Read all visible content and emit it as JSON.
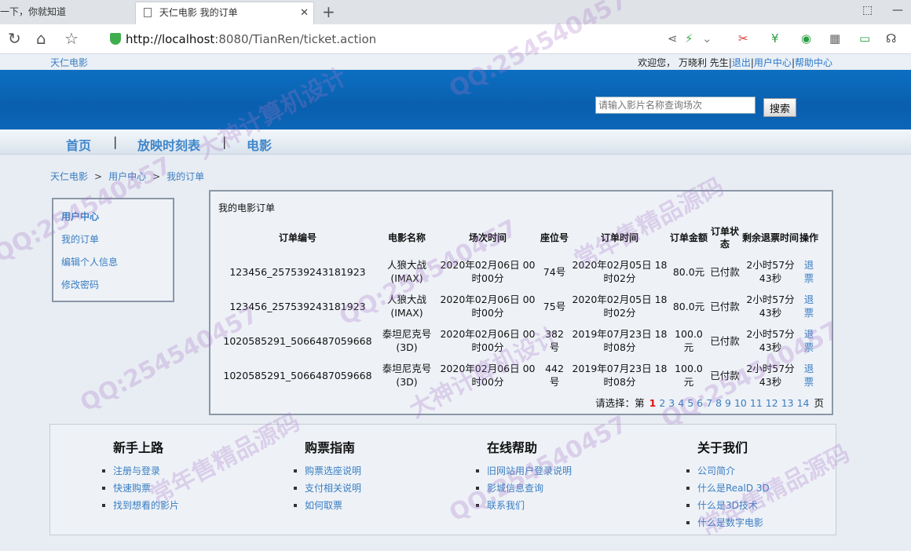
{
  "browser": {
    "inactive_tab_title": "一下，你就知道",
    "active_tab_title": "天仁电影 我的订单",
    "url_host": "http://localhost",
    "url_rest": ":8080/TianRen/ticket.action"
  },
  "site": {
    "name": "天仁电影",
    "welcome_text": "欢迎您， 万晓利 先生",
    "logout": "退出",
    "user_center": "用户中心",
    "help_center": "帮助中心",
    "search_placeholder": "请输入影片名称查询场次",
    "search_button": "搜索"
  },
  "nav": {
    "home": "首页",
    "schedule": "放映时刻表",
    "movies": "电影",
    "sep": "|"
  },
  "breadcrumb": {
    "items": [
      "天仁电影",
      "用户中心",
      "我的订单"
    ],
    "separator": ">"
  },
  "sidebar": {
    "title": "用户中心",
    "items": [
      "我的订单",
      "编辑个人信息",
      "修改密码"
    ]
  },
  "orders": {
    "title": "我的电影订单",
    "columns": [
      "订单编号",
      "电影名称",
      "场次时间",
      "座位号",
      "订单时间",
      "订单金额",
      "订单状态",
      "剩余退票时间",
      "操作"
    ],
    "rows": [
      [
        "123456_257539243181923",
        "人狼大战(IMAX)",
        "2020年02月06日 00时00分",
        "74号",
        "2020年02月05日 18时02分",
        "80.0元",
        "已付款",
        "2小时57分43秒",
        "退票"
      ],
      [
        "123456_257539243181923",
        "人狼大战(IMAX)",
        "2020年02月06日 00时00分",
        "75号",
        "2020年02月05日 18时02分",
        "80.0元",
        "已付款",
        "2小时57分43秒",
        "退票"
      ],
      [
        "1020585291_5066487059668",
        "泰坦尼克号(3D)",
        "2020年02月06日 00时00分",
        "382号",
        "2019年07月23日 18时08分",
        "100.0元",
        "已付款",
        "2小时57分43秒",
        "退票"
      ],
      [
        "1020585291_5066487059668",
        "泰坦尼克号(3D)",
        "2020年02月06日 00时00分",
        "442号",
        "2019年07月23日 18时08分",
        "100.0元",
        "已付款",
        "2小时57分43秒",
        "退票"
      ]
    ],
    "pager_prefix": "请选择：第",
    "pager_suffix": "页",
    "current_page": "1",
    "pages": [
      "2",
      "3",
      "4",
      "5",
      "6",
      "7",
      "8",
      "9",
      "10",
      "11",
      "12",
      "13",
      "14"
    ]
  },
  "footer": {
    "cols": [
      {
        "title": "新手上路",
        "items": [
          "注册与登录",
          "快速购票",
          "找到想看的影片"
        ]
      },
      {
        "title": "购票指南",
        "items": [
          "购票选座说明",
          "支付相关说明",
          "如何取票"
        ]
      },
      {
        "title": "在线帮助",
        "items": [
          "旧网站用户登录说明",
          "影城信息查询",
          "联系我们"
        ]
      },
      {
        "title": "关于我们",
        "items": [
          "公司简介",
          "什么是RealD 3D",
          "什么是3D技术",
          "什么是数字电影"
        ]
      }
    ]
  },
  "watermarks": [
    "QQ:254540457",
    "大神计算机设计",
    "常年售精品源码"
  ],
  "colors": {
    "link": "#3a7dc2",
    "banner": "#0d6fc2",
    "current_page": "#dd1111",
    "watermark": "#aa78c8"
  }
}
